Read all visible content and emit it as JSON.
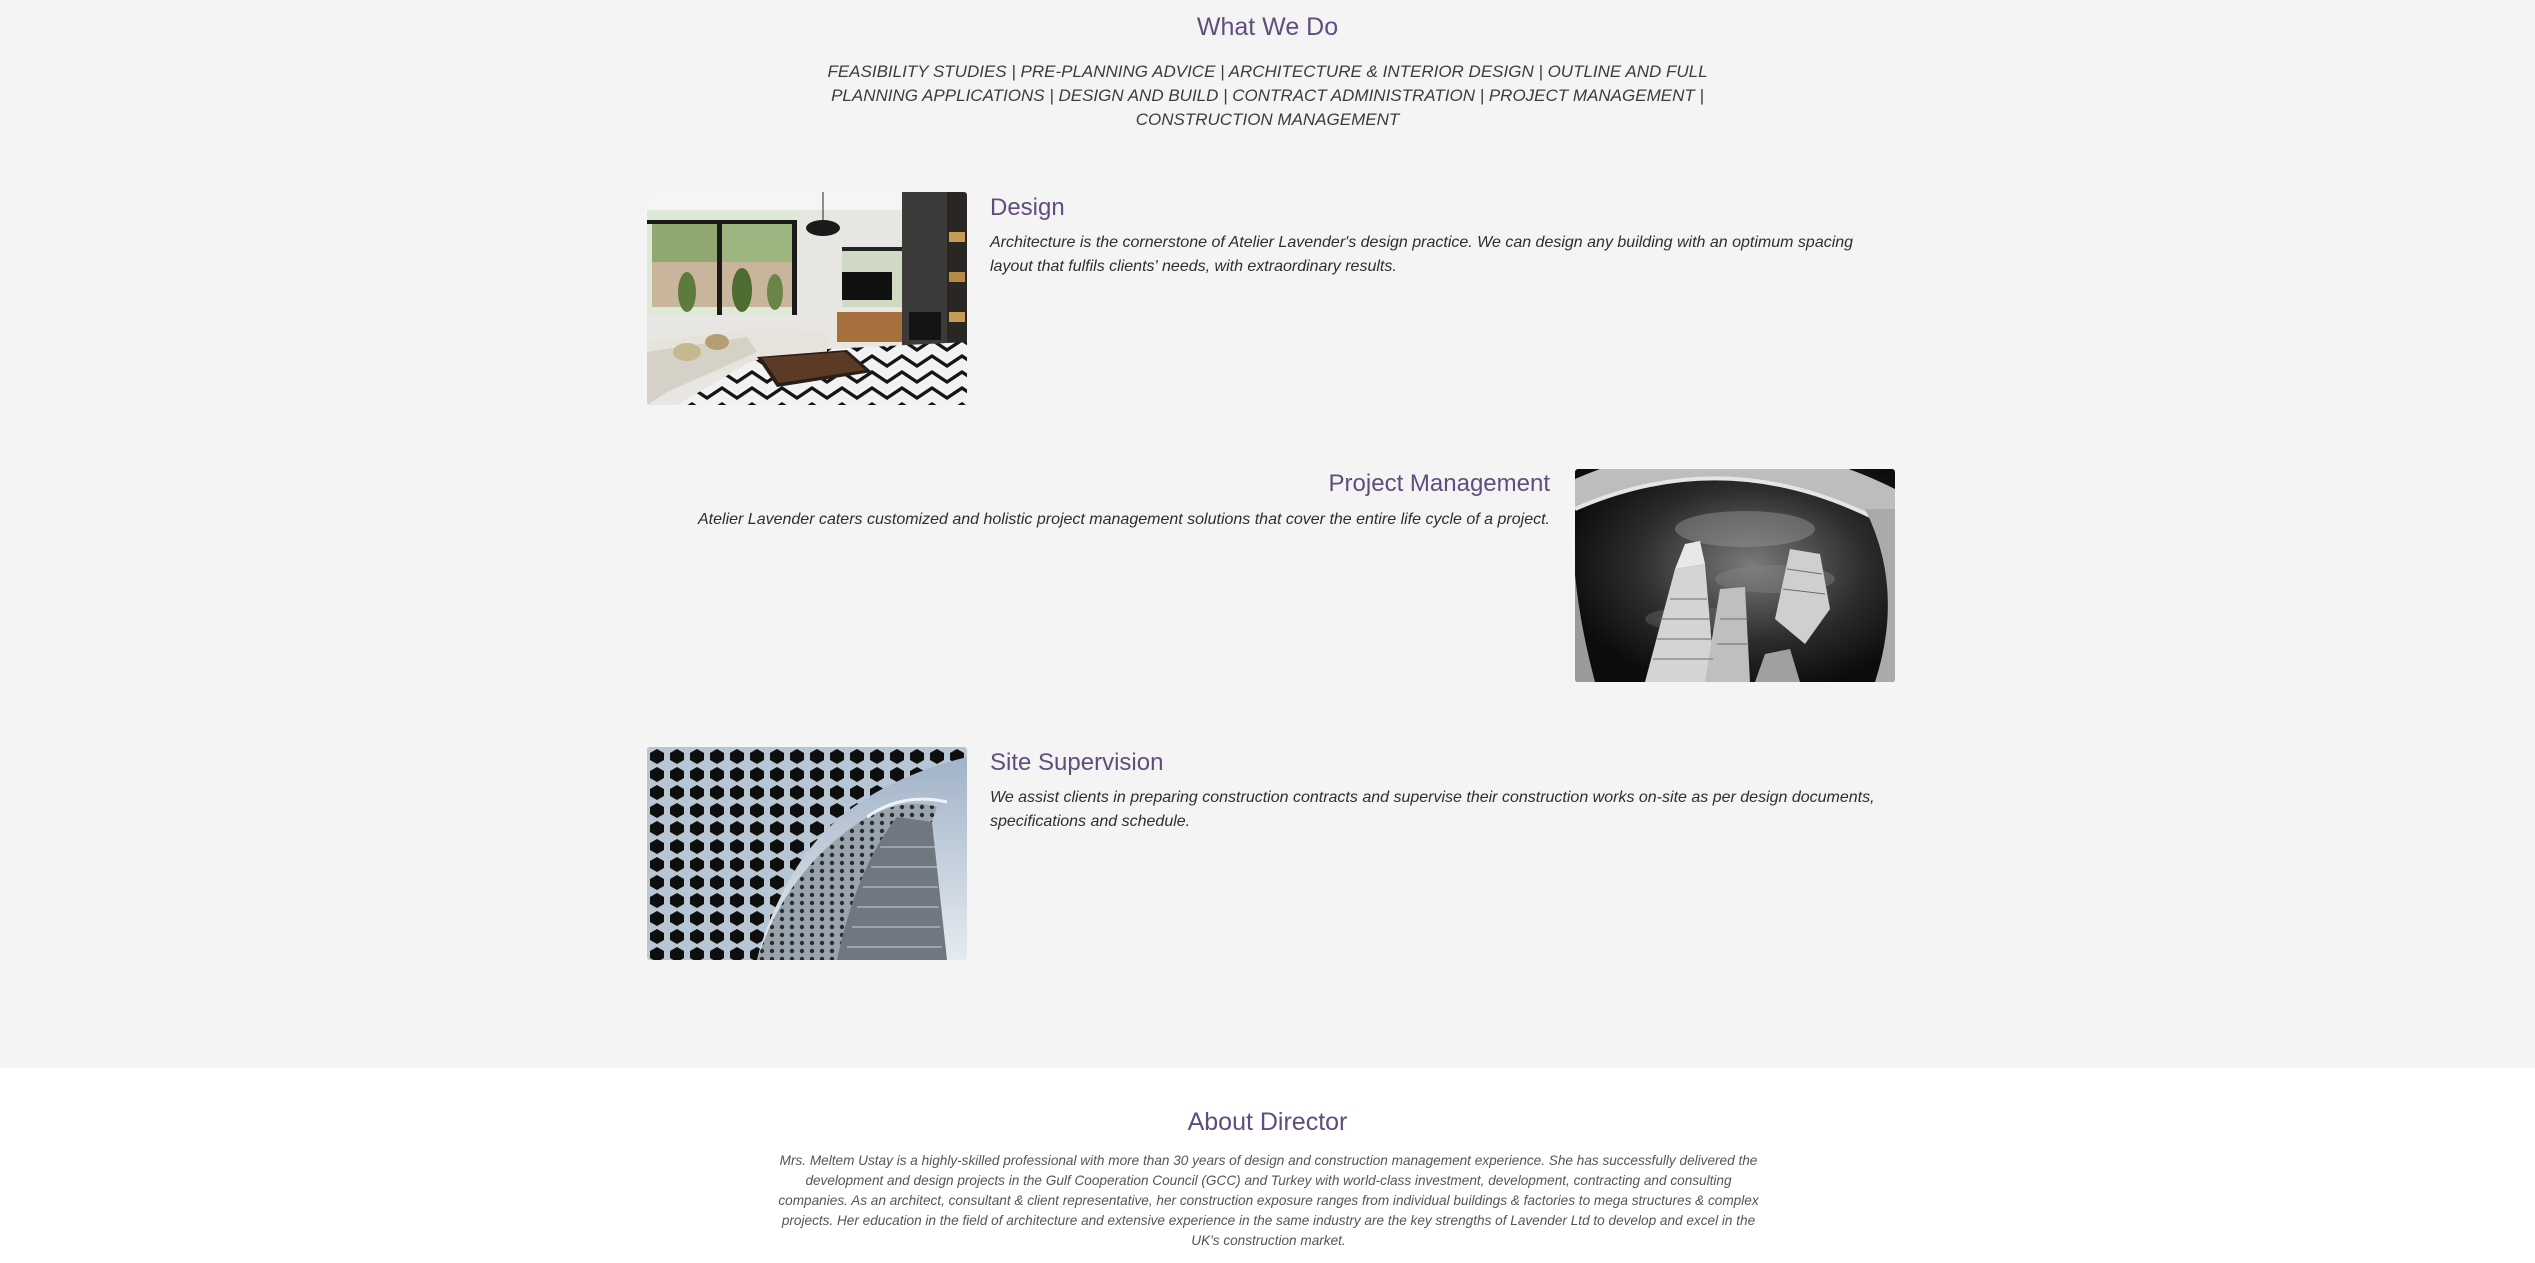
{
  "what_we_do": {
    "title": "What We Do",
    "services_line": "FEASIBILITY STUDIES | PRE-PLANNING ADVICE | ARCHITECTURE & INTERIOR DESIGN | OUTLINE AND FULL PLANNING APPLICATIONS | DESIGN AND BUILD | CONTRACT ADMINISTRATION | PROJECT MANAGEMENT | CONSTRUCTION MANAGEMENT",
    "services": [
      {
        "title": "Design",
        "description": "Architecture is the cornerstone of Atelier Lavender's design practice. We can design any building with an optimum spacing layout that fulfils clients' needs, with extraordinary results.",
        "image": "living-room-interior-photo"
      },
      {
        "title": "Project Management",
        "description": "Atelier Lavender caters customized and holistic project management solutions that cover the entire life cycle of a project.",
        "image": "skyscrapers-looking-up-photo"
      },
      {
        "title": "Site Supervision",
        "description": "We assist clients in preparing construction contracts and supervise their construction works on-site as per design documents, specifications and schedule.",
        "image": "perforated-facade-photo"
      }
    ]
  },
  "about_director": {
    "title": "About Director",
    "body": "Mrs. Meltem Ustay is a highly-skilled professional with more than 30 years of design and construction management experience. She has successfully delivered the development and design projects in the Gulf Cooperation Council (GCC) and Turkey with world-class investment, development, contracting and consulting companies. As an architect, consultant & client representative, her construction exposure ranges from individual buildings & factories to mega structures & complex projects. Her education in the field of architecture and extensive experience in the same industry are the key strengths of Lavender Ltd to develop and excel in the UK's construction market."
  },
  "colors": {
    "accent": "#614d7d",
    "section_background": "#f4f4f4",
    "about_background": "#ffffff",
    "body_text": "#2e2e2e"
  }
}
